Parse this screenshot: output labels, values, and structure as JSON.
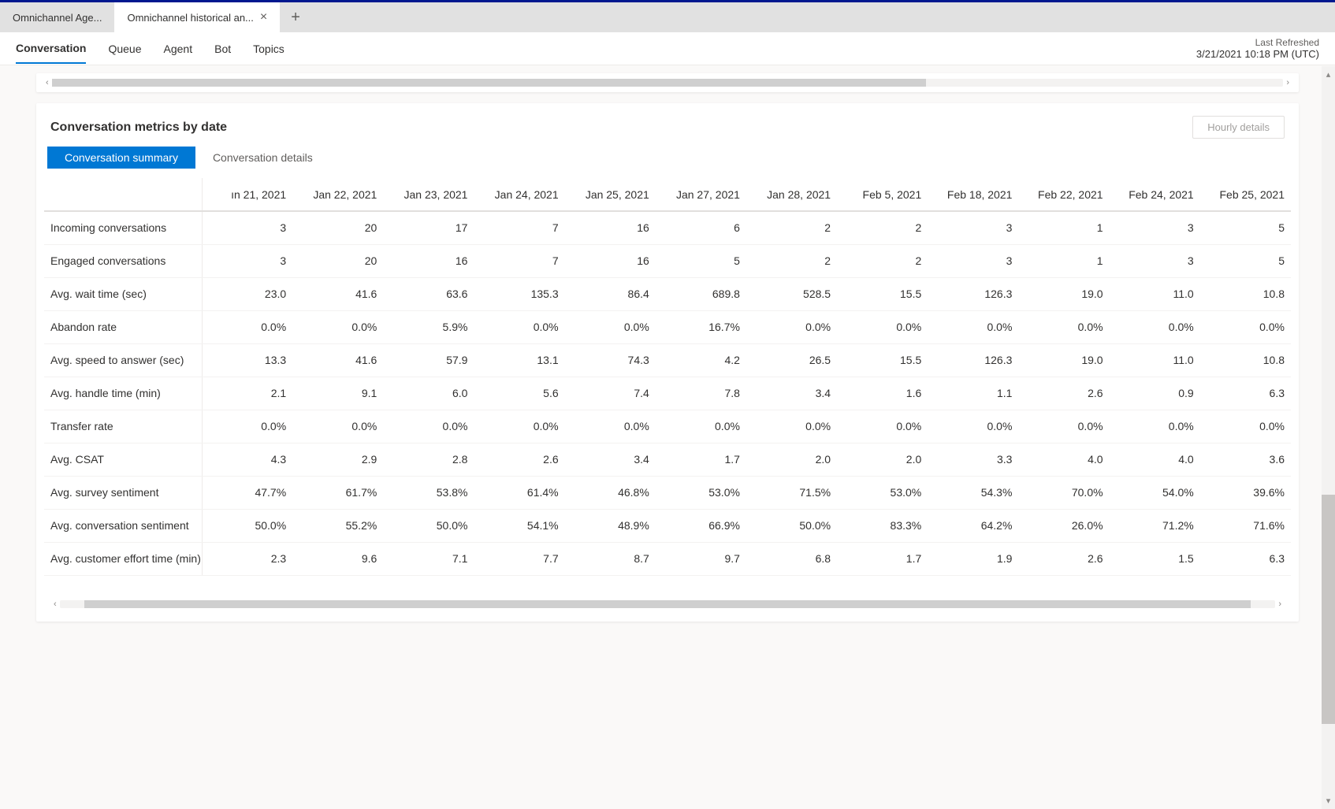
{
  "tabs": [
    {
      "label": "Omnichannel Age...",
      "active": false,
      "closeable": false
    },
    {
      "label": "Omnichannel historical an...",
      "active": true,
      "closeable": true
    }
  ],
  "nav": {
    "items": [
      "Conversation",
      "Queue",
      "Agent",
      "Bot",
      "Topics"
    ],
    "active_index": 0,
    "last_refreshed_label": "Last Refreshed",
    "last_refreshed_value": "3/21/2021 10:18 PM (UTC)"
  },
  "card": {
    "title": "Conversation metrics by date",
    "hourly_button": "Hourly details",
    "inner_tabs": [
      "Conversation summary",
      "Conversation details"
    ],
    "inner_active_index": 0
  },
  "chart_data": {
    "type": "table",
    "columns": [
      "ın 21, 2021",
      "Jan 22, 2021",
      "Jan 23, 2021",
      "Jan 24, 2021",
      "Jan 25, 2021",
      "Jan 27, 2021",
      "Jan 28, 2021",
      "Feb 5, 2021",
      "Feb 18, 2021",
      "Feb 22, 2021",
      "Feb 24, 2021",
      "Feb 25, 2021"
    ],
    "rows": [
      {
        "label": "Incoming conversations",
        "values": [
          "3",
          "20",
          "17",
          "7",
          "16",
          "6",
          "2",
          "2",
          "3",
          "1",
          "3",
          "5"
        ]
      },
      {
        "label": "Engaged conversations",
        "values": [
          "3",
          "20",
          "16",
          "7",
          "16",
          "5",
          "2",
          "2",
          "3",
          "1",
          "3",
          "5"
        ]
      },
      {
        "label": "Avg. wait time (sec)",
        "values": [
          "23.0",
          "41.6",
          "63.6",
          "135.3",
          "86.4",
          "689.8",
          "528.5",
          "15.5",
          "126.3",
          "19.0",
          "11.0",
          "10.8"
        ]
      },
      {
        "label": "Abandon rate",
        "values": [
          "0.0%",
          "0.0%",
          "5.9%",
          "0.0%",
          "0.0%",
          "16.7%",
          "0.0%",
          "0.0%",
          "0.0%",
          "0.0%",
          "0.0%",
          "0.0%"
        ]
      },
      {
        "label": "Avg. speed to answer (sec)",
        "values": [
          "13.3",
          "41.6",
          "57.9",
          "13.1",
          "74.3",
          "4.2",
          "26.5",
          "15.5",
          "126.3",
          "19.0",
          "11.0",
          "10.8"
        ]
      },
      {
        "label": "Avg. handle time (min)",
        "values": [
          "2.1",
          "9.1",
          "6.0",
          "5.6",
          "7.4",
          "7.8",
          "3.4",
          "1.6",
          "1.1",
          "2.6",
          "0.9",
          "6.3"
        ]
      },
      {
        "label": "Transfer rate",
        "values": [
          "0.0%",
          "0.0%",
          "0.0%",
          "0.0%",
          "0.0%",
          "0.0%",
          "0.0%",
          "0.0%",
          "0.0%",
          "0.0%",
          "0.0%",
          "0.0%"
        ]
      },
      {
        "label": "Avg. CSAT",
        "values": [
          "4.3",
          "2.9",
          "2.8",
          "2.6",
          "3.4",
          "1.7",
          "2.0",
          "2.0",
          "3.3",
          "4.0",
          "4.0",
          "3.6"
        ]
      },
      {
        "label": "Avg. survey sentiment",
        "values": [
          "47.7%",
          "61.7%",
          "53.8%",
          "61.4%",
          "46.8%",
          "53.0%",
          "71.5%",
          "53.0%",
          "54.3%",
          "70.0%",
          "54.0%",
          "39.6%"
        ]
      },
      {
        "label": "Avg. conversation sentiment",
        "values": [
          "50.0%",
          "55.2%",
          "50.0%",
          "54.1%",
          "48.9%",
          "66.9%",
          "50.0%",
          "83.3%",
          "64.2%",
          "26.0%",
          "71.2%",
          "71.6%"
        ]
      },
      {
        "label": "Avg. customer effort time (min)",
        "values": [
          "2.3",
          "9.6",
          "7.1",
          "7.7",
          "8.7",
          "9.7",
          "6.8",
          "1.7",
          "1.9",
          "2.6",
          "1.5",
          "6.3"
        ]
      }
    ]
  }
}
